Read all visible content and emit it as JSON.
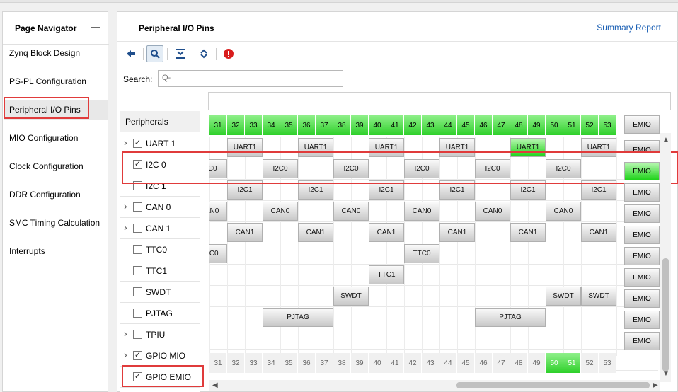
{
  "nav": {
    "title": "Page Navigator",
    "minimize": "—",
    "items": [
      {
        "label": "Zynq Block Design"
      },
      {
        "label": "PS-PL Configuration"
      },
      {
        "label": "Peripheral I/O Pins"
      },
      {
        "label": "MIO Configuration"
      },
      {
        "label": "Clock Configuration"
      },
      {
        "label": "DDR Configuration"
      },
      {
        "label": "SMC Timing Calculation"
      },
      {
        "label": "Interrupts"
      }
    ],
    "active_index": 2
  },
  "main": {
    "title": "Peripheral I/O Pins",
    "summary_link": "Summary Report",
    "search_label": "Search:",
    "search_placeholder": "Q-"
  },
  "toolbar": {
    "icons": [
      "back-arrow-icon",
      "search-icon",
      "collapse-all-icon",
      "expand-all-icon",
      "error-icon"
    ]
  },
  "peripherals": {
    "header": "Peripherals",
    "rows": [
      {
        "label": "UART 1",
        "checked": true,
        "expandable": true
      },
      {
        "label": "I2C 0",
        "checked": true,
        "expandable": false
      },
      {
        "label": "I2C 1",
        "checked": false,
        "expandable": false
      },
      {
        "label": "CAN 0",
        "checked": false,
        "expandable": true
      },
      {
        "label": "CAN 1",
        "checked": false,
        "expandable": true
      },
      {
        "label": "TTC0",
        "checked": false,
        "expandable": false
      },
      {
        "label": "TTC1",
        "checked": false,
        "expandable": false
      },
      {
        "label": "SWDT",
        "checked": false,
        "expandable": false
      },
      {
        "label": "PJTAG",
        "checked": false,
        "expandable": false
      },
      {
        "label": "TPIU",
        "checked": false,
        "expandable": true
      },
      {
        "label": "GPIO MIO",
        "checked": true,
        "expandable": true
      },
      {
        "label": "GPIO EMIO",
        "checked": true,
        "expandable": false
      }
    ]
  },
  "grid": {
    "pin_numbers": [
      "31",
      "32",
      "33",
      "34",
      "35",
      "36",
      "37",
      "38",
      "39",
      "40",
      "41",
      "42",
      "43",
      "44",
      "45",
      "46",
      "47",
      "48",
      "49",
      "50",
      "51",
      "52",
      "53"
    ],
    "emio_label": "EMIO",
    "footer_green_pins": [
      "50",
      "51"
    ],
    "rows": {
      "uart1": "UART1",
      "i2c0": "I2C0",
      "i2c1": "I2C1",
      "can0": "CAN0",
      "can1": "CAN1",
      "ttc0": "TTC0",
      "ttc1": "TTC1",
      "swdt": "SWDT",
      "pjtag": "PJTAG"
    }
  },
  "colors": {
    "highlight_red": "#e03b3b",
    "pin_green": "#2ed02a",
    "link_blue": "#1a5fb4"
  }
}
